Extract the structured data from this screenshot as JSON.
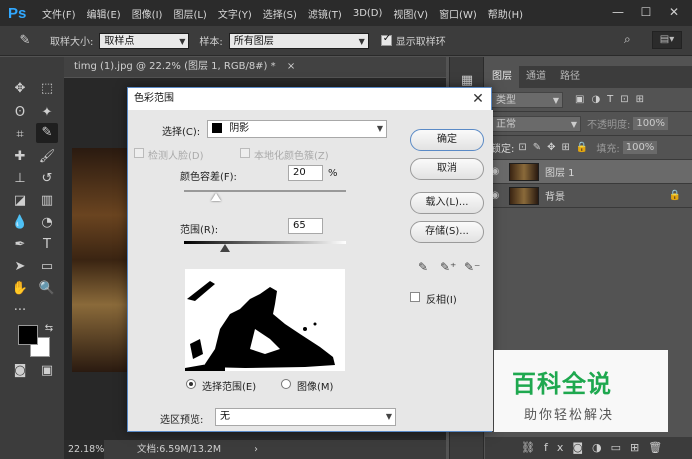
{
  "app": {
    "logo": "Ps",
    "menu": [
      "文件(F)",
      "编辑(E)",
      "图像(I)",
      "图层(L)",
      "文字(Y)",
      "选择(S)",
      "滤镜(T)",
      "3D(D)",
      "视图(V)",
      "窗口(W)",
      "帮助(H)"
    ],
    "window_buttons": [
      "—",
      "☐",
      "✕"
    ]
  },
  "options": {
    "sample_size_label": "取样大小:",
    "sample_size_value": "取样点",
    "sample_label": "样本:",
    "sample_value": "所有图层",
    "show_ring_label": "显示取样环",
    "show_ring_checked": true
  },
  "document": {
    "tab_title": "timg (1).jpg @ 22.2% (图层 1, RGB/8#) *",
    "tab_close": "×",
    "zoom": "22.18%",
    "doc_info": "文档:6.59M/13.2M"
  },
  "layers_panel": {
    "tabs": [
      "图层",
      "通道",
      "路径"
    ],
    "kind_filter": "类型",
    "blend_mode": "正常",
    "opacity_label": "不透明度:",
    "opacity_value": "100%",
    "lock_label": "锁定:",
    "fill_label": "填充:",
    "fill_value": "100%",
    "layers": [
      {
        "name": "图层 1",
        "visible": true,
        "locked": false
      },
      {
        "name": "背景",
        "visible": true,
        "locked": true
      }
    ]
  },
  "dialog": {
    "title": "色彩范围",
    "select_label": "选择(C):",
    "select_value": "阴影",
    "detect_faces_label": "检测人脸(D)",
    "localized_label": "本地化颜色簇(Z)",
    "fuzziness_label": "颜色容差(F):",
    "fuzziness_value": "20",
    "fuzziness_unit": "%",
    "range_label": "范围(R):",
    "range_value": "65",
    "radio_selection": "选择范围(E)",
    "radio_image": "图像(M)",
    "preview_label": "选区预览:",
    "preview_value": "无",
    "ok_button": "确定",
    "cancel_button": "取消",
    "load_button": "载入(L)...",
    "save_button": "存储(S)...",
    "invert_label": "反相(I)"
  },
  "watermark": {
    "big": "百科全说",
    "small": "助你轻松解决"
  }
}
